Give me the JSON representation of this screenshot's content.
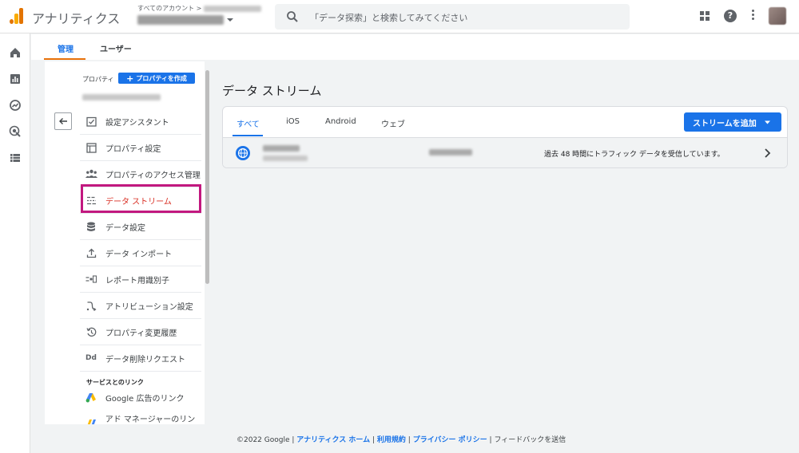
{
  "app": {
    "title": "アナリティクス"
  },
  "account": {
    "crumb": "すべてのアカウント >"
  },
  "search": {
    "placeholder": "「データ探索」と検索してみてください"
  },
  "tabs": [
    {
      "label": "管理"
    },
    {
      "label": "ユーザー"
    }
  ],
  "property_menu": {
    "label": "プロパティ",
    "create_button": "プロパティを作成",
    "items": [
      {
        "label": "設定アシスタント",
        "icon": "checklist-icon"
      },
      {
        "label": "プロパティ設定",
        "icon": "layout-icon"
      },
      {
        "label": "プロパティのアクセス管理",
        "icon": "people-icon"
      },
      {
        "label": "データ ストリーム",
        "icon": "streams-icon",
        "selected": true
      },
      {
        "label": "データ設定",
        "icon": "database-icon"
      },
      {
        "label": "データ インポート",
        "icon": "upload-icon"
      },
      {
        "label": "レポート用識別子",
        "icon": "identity-icon"
      },
      {
        "label": "アトリビューション設定",
        "icon": "attribution-icon"
      },
      {
        "label": "プロパティ変更履歴",
        "icon": "history-icon"
      },
      {
        "label": "データ削除リクエスト",
        "icon": "dd-icon",
        "icon_text": "Dd"
      }
    ],
    "links_section": "サービスとのリンク",
    "link_items": [
      {
        "label": "Google 広告のリンク",
        "icon": "google-ads-icon"
      },
      {
        "label": "アド マネージャーのリンク",
        "icon": "ad-manager-icon"
      }
    ]
  },
  "main": {
    "title": "データ ストリーム",
    "filter_tabs": [
      {
        "label": "すべて",
        "active": true
      },
      {
        "label": "iOS"
      },
      {
        "label": "Android"
      },
      {
        "label": "ウェブ"
      }
    ],
    "add_button": "ストリームを追加",
    "stream": {
      "status": "過去 48 時間にトラフィック データを受信しています。"
    }
  },
  "footer": {
    "copyright": "©2022 Google |",
    "links": [
      "アナリティクス ホーム",
      "利用規約",
      "プライバシー ポリシー"
    ],
    "feedback": "フィードバックを送信"
  },
  "colors": {
    "accent": "#1a73e8",
    "tab_underline": "#e8710a",
    "selected_item": "#d93025",
    "highlight_box": "#c2187f"
  }
}
